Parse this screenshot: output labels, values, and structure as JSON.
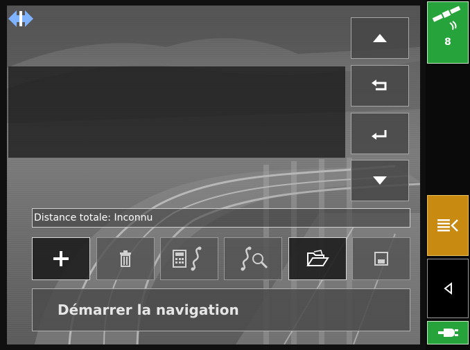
{
  "screen": "route-planner",
  "route": {
    "distance_label": "Distance totale: Inconnu",
    "start_navigation_label": "Démarrer la navigation"
  },
  "scroll_buttons": [
    {
      "name": "scroll-up-button",
      "icon": "triangle-up-icon"
    },
    {
      "name": "move-up-button",
      "icon": "return-left-icon"
    },
    {
      "name": "move-down-button",
      "icon": "return-right-icon"
    },
    {
      "name": "scroll-down-button",
      "icon": "triangle-down-icon"
    }
  ],
  "toolbar": [
    {
      "name": "add-waypoint-button",
      "icon": "plus-icon",
      "enabled": true
    },
    {
      "name": "delete-waypoint-button",
      "icon": "trash-icon",
      "enabled": false
    },
    {
      "name": "calculate-route-button",
      "icon": "calculator-route-icon",
      "enabled": false
    },
    {
      "name": "view-route-button",
      "icon": "route-zoom-icon",
      "enabled": false
    },
    {
      "name": "open-route-button",
      "icon": "folder-open-icon",
      "enabled": true
    },
    {
      "name": "save-route-button",
      "icon": "floppy-disk-icon",
      "enabled": false
    }
  ],
  "status": {
    "satellite_count": "8",
    "gps_icon": "satellite-icon",
    "power_icon": "power-plug-icon"
  },
  "colors": {
    "gps_green": "#26a33a",
    "menu_orange": "#c88a10",
    "logo_blue": "#7fb2ff"
  }
}
